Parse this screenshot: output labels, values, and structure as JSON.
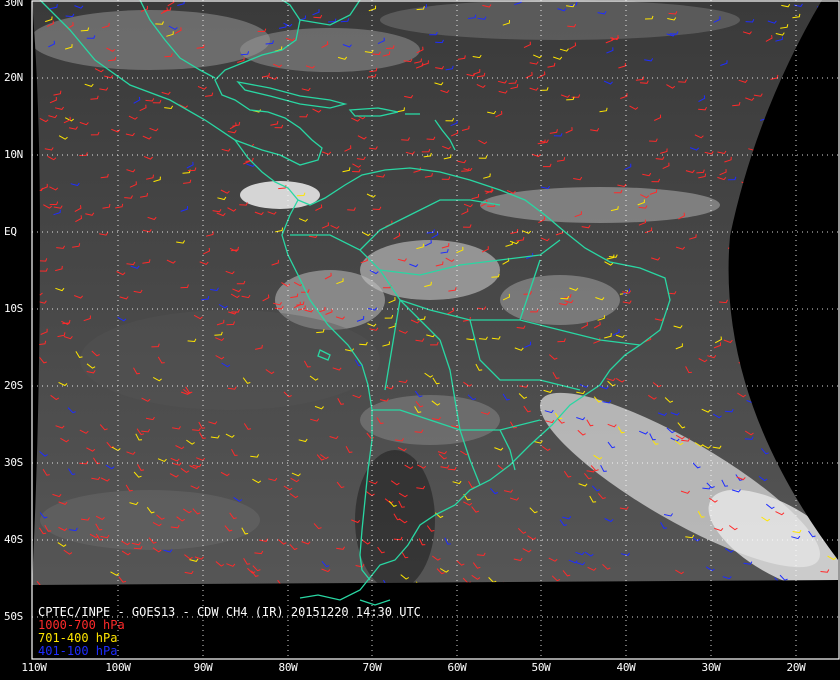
{
  "caption": {
    "title": "CPTEC/INPE - GOES13 - CDW CH4 (IR) 20151220 14:30 UTC"
  },
  "legend": [
    {
      "label": "1000-700 hPa",
      "color": "#ff2a2a"
    },
    {
      "label": "701-400 hPa",
      "color": "#ffe600"
    },
    {
      "label": "401-100 hPa",
      "color": "#1e2dff"
    }
  ],
  "lat_labels": [
    "30N",
    "20N",
    "10N",
    "EQ",
    "10S",
    "20S",
    "30S",
    "40S",
    "50S"
  ],
  "lon_labels": [
    "110W",
    "100W",
    "90W",
    "80W",
    "70W",
    "60W",
    "50W",
    "40W",
    "30W",
    "20W"
  ],
  "colors": {
    "coastline": "#29d7a3",
    "grid": "#ffffff",
    "space": "#000000"
  }
}
